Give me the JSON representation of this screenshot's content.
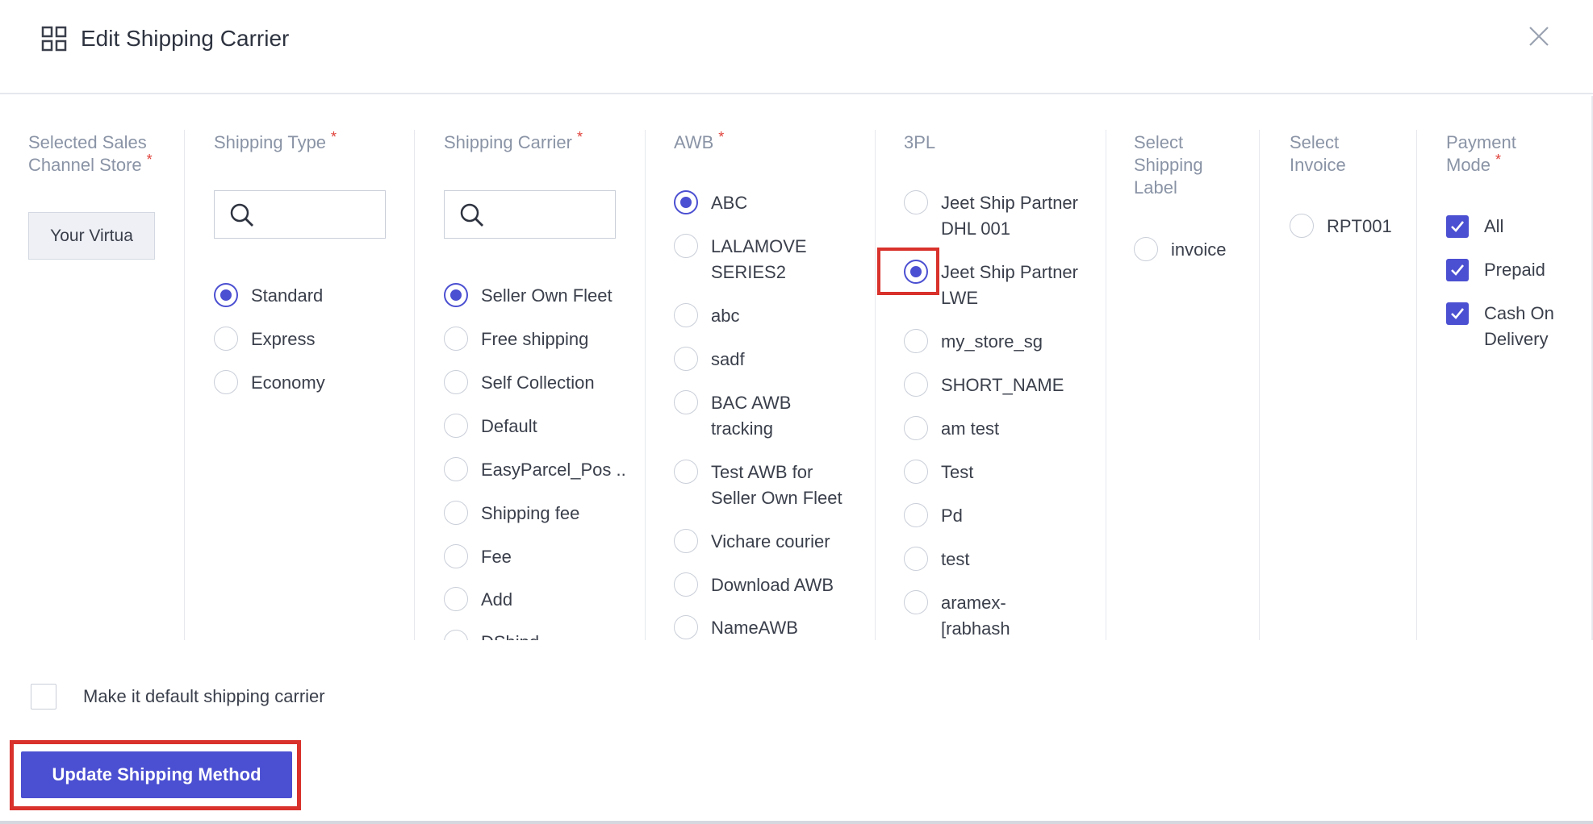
{
  "dialog": {
    "title": "Edit Shipping Carrier"
  },
  "columns": {
    "sales_channel": {
      "label": "Selected Sales Channel Store",
      "store_button": "Your Virtua"
    },
    "shipping_type": {
      "label": "Shipping Type",
      "options": [
        "Standard",
        "Express",
        "Economy"
      ],
      "selected": "Standard"
    },
    "shipping_carrier": {
      "label": "Shipping Carrier",
      "options": [
        "Seller Own Fleet",
        "Free shipping",
        "Self Collection",
        "Default",
        "EasyParcel_Pos ..",
        "Shipping fee",
        "Fee",
        "Add",
        "DShipd"
      ],
      "selected": "Seller Own Fleet"
    },
    "awb": {
      "label": "AWB",
      "options": [
        "ABC",
        "LALAMOVE SERIES2",
        "abc",
        "sadf",
        "BAC AWB tracking",
        "Test AWB for Seller Own Fleet",
        "Vichare courier",
        "Download AWB",
        "NameAWB"
      ],
      "selected": "ABC"
    },
    "three_pl": {
      "label": "3PL",
      "options": [
        "Jeet Ship Partner DHL 001",
        "Jeet Ship Partner LWE",
        "my_store_sg",
        "SHORT_NAME",
        "am test",
        "Test",
        "Pd",
        "test",
        "aramex-[rabhash"
      ],
      "selected": "Jeet Ship Partner LWE"
    },
    "shipping_label": {
      "label": "Select Shipping Label",
      "options": [
        "invoice"
      ]
    },
    "invoice": {
      "label": "Select Invoice",
      "options": [
        "RPT001"
      ]
    },
    "payment_mode": {
      "label": "Payment Mode",
      "options": [
        "All",
        "Prepaid",
        "Cash On Delivery"
      ],
      "checked": [
        true,
        true,
        true
      ]
    }
  },
  "footer": {
    "default_label": "Make it default shipping carrier",
    "update_button": "Update Shipping Method"
  },
  "colors": {
    "accent": "#4b4fd1",
    "required": "#e0413a",
    "highlight": "#d9312b"
  }
}
